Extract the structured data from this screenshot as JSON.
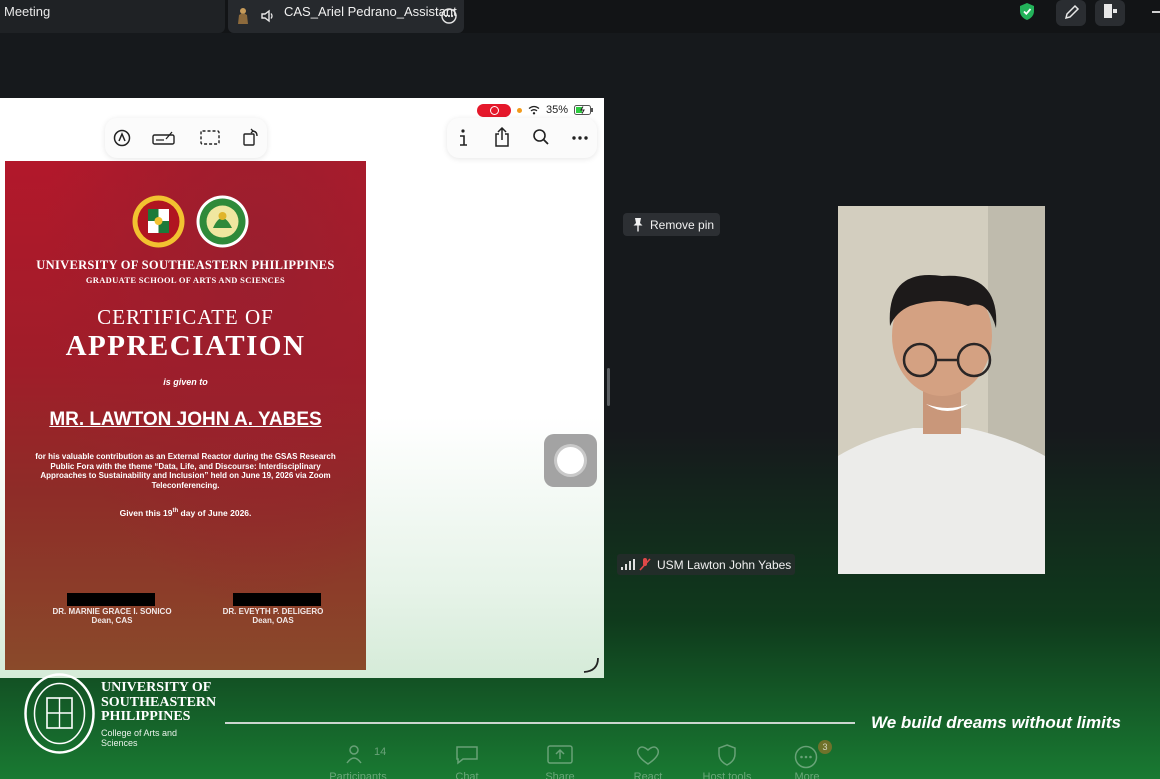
{
  "topbar": {
    "meeting_tab_label": "Meeting",
    "share_tab_label": "CAS_Ariel Pedrano_Assistant",
    "icons": [
      "raise-hand-icon",
      "speaker-icon",
      "more-icon",
      "shield-icon",
      "pencil-icon",
      "exit-icon"
    ]
  },
  "shared_screen": {
    "battery": "35%",
    "left_tools": [
      "markup-icon",
      "signature-icon",
      "select-icon",
      "rotate-icon"
    ],
    "right_tools": [
      "info-icon",
      "share-icon",
      "search-icon",
      "more-icon"
    ],
    "certificate": {
      "university": "UNIVERSITY OF SOUTHEASTERN PHILIPPINES",
      "school": "GRADUATE SCHOOL OF ARTS AND SCIENCES",
      "heading_1": "CERTIFICATE OF",
      "heading_2": "APPRECIATION",
      "given_to": "is given to",
      "recipient": "MR. LAWTON JOHN A. YABES",
      "body": "for his valuable contribution as an External Reactor during the GSAS Research Public Fora with the theme “Data, Life, and Discourse: Interdisciplinary Approaches to Sustainability and Inclusion” held on June 19, 2026 via Zoom Teleconferencing.",
      "date_prefix": "Given this 19",
      "date_sup": "th",
      "date_suffix": " day of June 2026.",
      "signatory_1_name": "DR. MARNIE GRACE I. SONICO",
      "signatory_1_title": "Dean, CAS",
      "signatory_2_name": "DR. EVEYTH P. DELIGERO",
      "signatory_2_title": "Dean, OAS"
    }
  },
  "participant": {
    "remove_pin_label": "Remove pin",
    "name": "USM Lawton John Yabes"
  },
  "branding": {
    "univ_line_1": "UNIVERSITY OF",
    "univ_line_2": "SOUTHEASTERN",
    "univ_line_3": "PHILIPPINES",
    "college_line_1": "College of Arts and",
    "college_line_2": "Sciences",
    "tagline": "We build dreams without limits"
  },
  "controls": {
    "participants_count": "14",
    "participants": "Participants",
    "chat": "Chat",
    "share": "Share",
    "react": "React",
    "host_tools": "Host tools",
    "more": "More",
    "more_badge": "3"
  },
  "colors": {
    "cert_red": "#b2182b",
    "accent_green": "#2ecc71",
    "bg_dark": "#16191c"
  }
}
